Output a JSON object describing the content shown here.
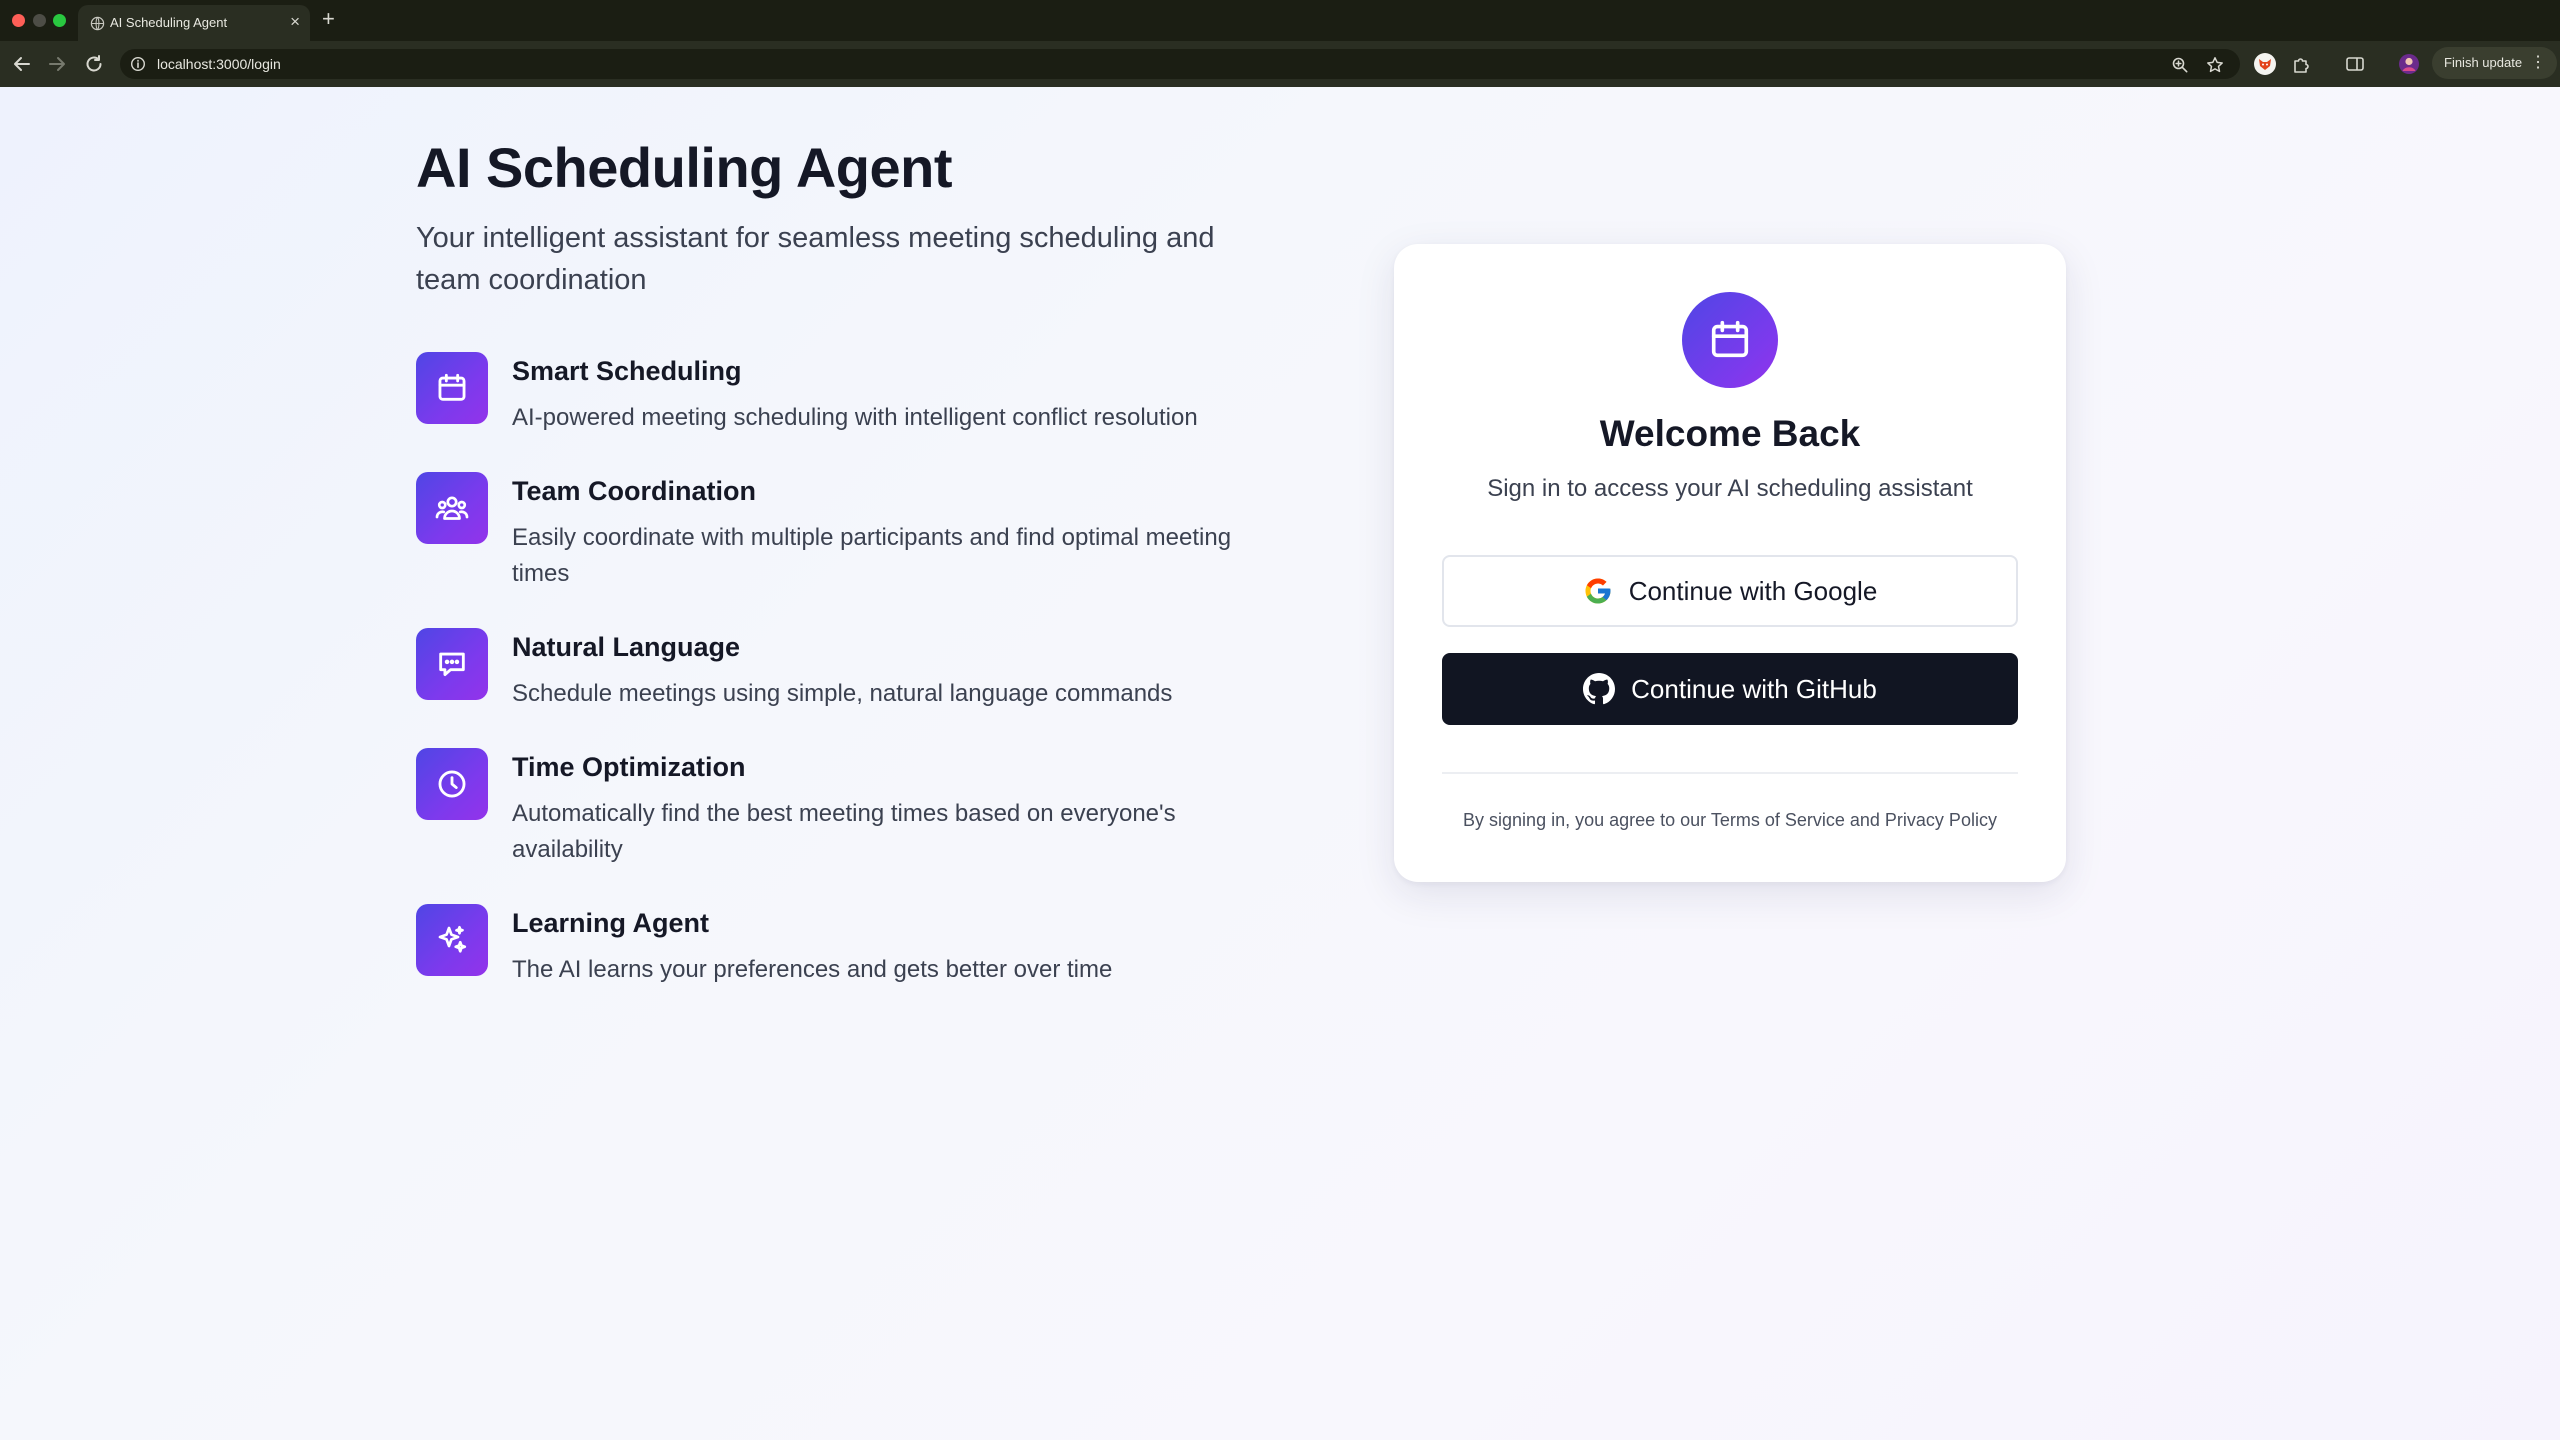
{
  "browser": {
    "tab_title": "AI Scheduling Agent",
    "tab_close": "×",
    "new_tab": "+",
    "url": "localhost:3000/login",
    "finish_update_label": "Finish update"
  },
  "hero": {
    "title": "AI Scheduling Agent",
    "subtitle": "Your intelligent assistant for seamless meeting scheduling and team coordination"
  },
  "features": [
    {
      "icon": "calendar-icon",
      "title": "Smart Scheduling",
      "description": "AI-powered meeting scheduling with intelligent conflict resolution"
    },
    {
      "icon": "team-icon",
      "title": "Team Coordination",
      "description": "Easily coordinate with multiple participants and find optimal meeting times"
    },
    {
      "icon": "chat-icon",
      "title": "Natural Language",
      "description": "Schedule meetings using simple, natural language commands"
    },
    {
      "icon": "clock-icon",
      "title": "Time Optimization",
      "description": "Automatically find the best meeting times based on everyone's availability"
    },
    {
      "icon": "sparkles-icon",
      "title": "Learning Agent",
      "description": "The AI learns your preferences and gets better over time"
    }
  ],
  "login": {
    "title": "Welcome Back",
    "subtitle": "Sign in to access your AI scheduling assistant",
    "google_label": "Continue with Google",
    "github_label": "Continue with GitHub",
    "terms": "By signing in, you agree to our Terms of Service and Privacy Policy"
  },
  "colors": {
    "accent_start": "#4f46e5",
    "accent_end": "#9333ea",
    "github_button": "#111522",
    "heading": "#151826",
    "body_text": "#3b4150"
  }
}
